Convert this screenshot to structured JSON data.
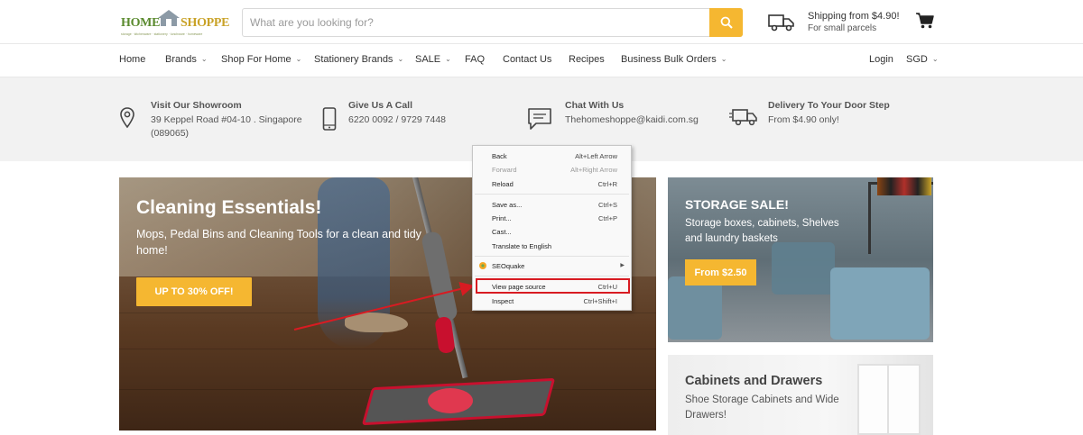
{
  "logo": {
    "word1": "HOME",
    "word2": "SHOPPE",
    "tagline": "storage · kitchenware · stationery · lunchware · homeware"
  },
  "search": {
    "placeholder": "What are you looking for?"
  },
  "shipping": {
    "line1": "Shipping from $4.90!",
    "line2": "For small parcels"
  },
  "nav": {
    "items": [
      {
        "label": "Home",
        "has_dropdown": false
      },
      {
        "label": "Brands",
        "has_dropdown": true
      },
      {
        "label": "Shop For Home",
        "has_dropdown": true
      },
      {
        "label": "Stationery Brands",
        "has_dropdown": true
      },
      {
        "label": "SALE",
        "has_dropdown": true
      },
      {
        "label": "FAQ",
        "has_dropdown": false
      },
      {
        "label": "Contact Us",
        "has_dropdown": false
      },
      {
        "label": "Recipes",
        "has_dropdown": false
      },
      {
        "label": "Business Bulk Orders",
        "has_dropdown": true
      }
    ],
    "login": "Login",
    "currency": "SGD",
    "dropdown_glyph": "⌄"
  },
  "info": [
    {
      "icon": "map-pin-icon",
      "title": "Visit Our Showroom",
      "line1": "39 Keppel Road #04-10 . Singapore",
      "line2": "(089065)"
    },
    {
      "icon": "phone-icon",
      "title": "Give Us A Call",
      "line1": "6220 0092 / 9729 7448",
      "line2": ""
    },
    {
      "icon": "chat-icon",
      "title": "Chat With Us",
      "line1": "Thehomeshoppe@kaidi.com.sg",
      "line2": ""
    },
    {
      "icon": "delivery-truck-icon",
      "title": "Delivery To Your Door Step",
      "line1": "From $4.90 only!",
      "line2": ""
    }
  ],
  "hero": {
    "title": "Cleaning Essentials!",
    "subtitle": "Mops, Pedal Bins and Cleaning Tools for a clean and tidy home!",
    "button": "UP TO 30% OFF!"
  },
  "promo_storage": {
    "title": "STORAGE SALE!",
    "subtitle": "Storage boxes, cabinets, Shelves and laundry baskets",
    "button": "From $2.50"
  },
  "promo_cabinets": {
    "title": "Cabinets and Drawers",
    "subtitle": "Shoe Storage Cabinets and Wide Drawers!"
  },
  "context_menu": {
    "items": [
      {
        "label": "Back",
        "shortcut": "Alt+Left Arrow",
        "disabled": false
      },
      {
        "label": "Forward",
        "shortcut": "Alt+Right Arrow",
        "disabled": true
      },
      {
        "label": "Reload",
        "shortcut": "Ctrl+R",
        "disabled": false
      },
      {
        "label": "Save as...",
        "shortcut": "Ctrl+S",
        "disabled": false
      },
      {
        "label": "Print...",
        "shortcut": "Ctrl+P",
        "disabled": false
      },
      {
        "label": "Cast...",
        "shortcut": "",
        "disabled": false
      },
      {
        "label": "Translate to English",
        "shortcut": "",
        "disabled": false
      },
      {
        "label": "SEOquake",
        "shortcut": "",
        "disabled": false,
        "submenu": true
      },
      {
        "label": "View page source",
        "shortcut": "Ctrl+U",
        "disabled": false,
        "highlighted": true
      },
      {
        "label": "Inspect",
        "shortcut": "Ctrl+Shift+I",
        "disabled": false
      }
    ],
    "highlight_color": "#d81b22",
    "submenu_glyph": "▶"
  },
  "colors": {
    "accent": "#f5b731",
    "annotation_red": "#d81b22"
  }
}
